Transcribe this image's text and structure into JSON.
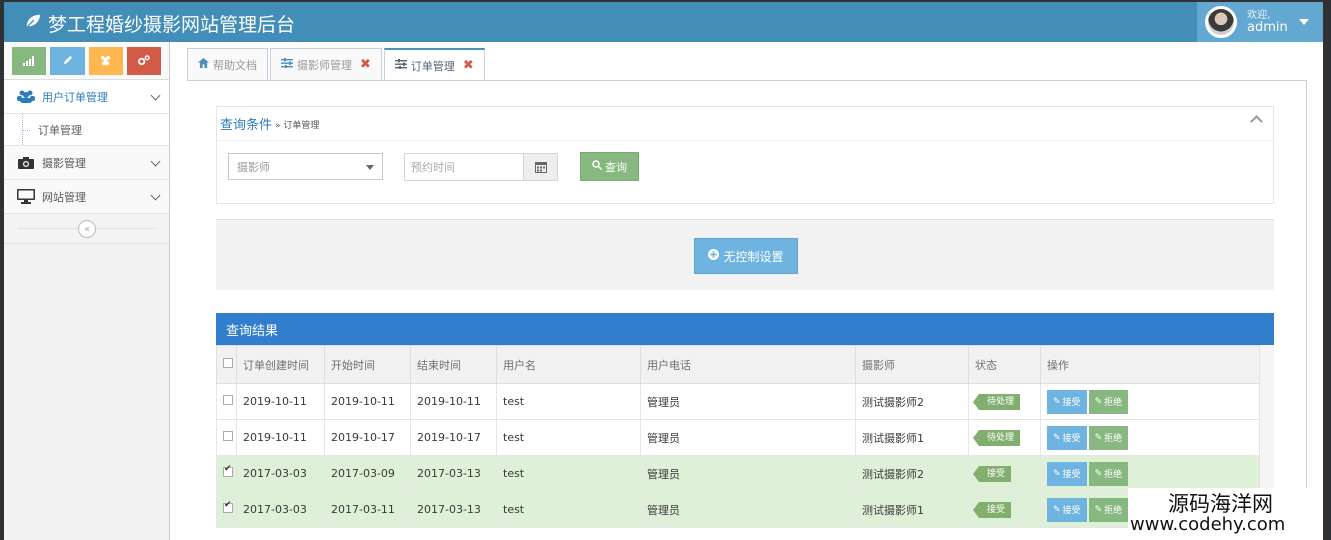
{
  "brand": {
    "title": "梦工程婚纱摄影网站管理后台"
  },
  "user": {
    "welcome": "欢迎,",
    "name": "admin"
  },
  "sidebar": {
    "items": [
      {
        "label": "用户订单管理",
        "icon": "users-icon",
        "children": [
          "订单管理"
        ]
      },
      {
        "label": "摄影管理",
        "icon": "camera-icon"
      },
      {
        "label": "网站管理",
        "icon": "desktop-icon"
      }
    ]
  },
  "tabs": [
    {
      "label": "帮助文档",
      "icon": "home-icon",
      "closable": false
    },
    {
      "label": "摄影师管理",
      "icon": "sliders-icon",
      "closable": true
    },
    {
      "label": "订单管理",
      "icon": "sliders-icon",
      "closable": true
    }
  ],
  "query": {
    "title": "查询条件",
    "subtitle": "» 订单管理",
    "photographer_placeholder": "摄影师",
    "date_placeholder": "预约时间",
    "search_label": "查询"
  },
  "actions": {
    "no_action_label": "无控制设置"
  },
  "results": {
    "title": "查询结果",
    "columns": [
      "订单创建时间",
      "开始时间",
      "结束时间",
      "用户名",
      "用户电话",
      "摄影师",
      "状态",
      "操作"
    ],
    "accept_label": "接受",
    "reject_label": "拒绝",
    "rows": [
      {
        "checked": false,
        "created": "2019-10-11",
        "start": "2019-10-11",
        "end": "2019-10-11",
        "user": "test",
        "phone": "管理员",
        "photographer": "测试摄影师2",
        "status": "待处理"
      },
      {
        "checked": false,
        "created": "2019-10-11",
        "start": "2019-10-17",
        "end": "2019-10-17",
        "user": "test",
        "phone": "管理员",
        "photographer": "测试摄影师1",
        "status": "待处理"
      },
      {
        "checked": true,
        "created": "2017-03-03",
        "start": "2017-03-09",
        "end": "2017-03-13",
        "user": "test",
        "phone": "管理员",
        "photographer": "测试摄影师2",
        "status": "接受"
      },
      {
        "checked": true,
        "created": "2017-03-03",
        "start": "2017-03-11",
        "end": "2017-03-13",
        "user": "test",
        "phone": "管理员",
        "photographer": "测试摄影师1",
        "status": "接受"
      }
    ]
  },
  "watermark": {
    "line1": "源码海洋网",
    "line2": "www.codehy.com"
  }
}
